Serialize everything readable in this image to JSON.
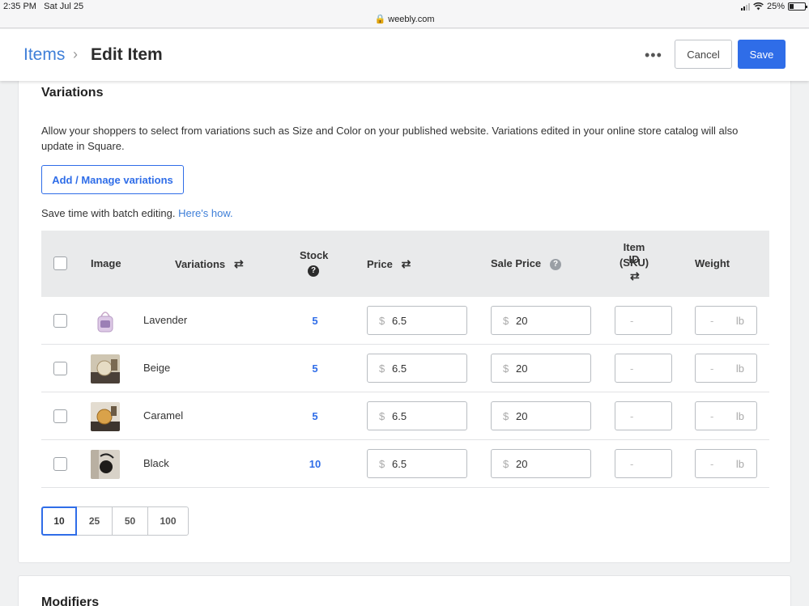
{
  "status_bar": {
    "time": "2:35 PM",
    "date": "Sat Jul 25",
    "url": "weebly.com",
    "battery": "25%"
  },
  "header": {
    "breadcrumb_link": "Items",
    "breadcrumb_sep": "›",
    "title": "Edit Item",
    "more": "•••",
    "cancel_label": "Cancel",
    "save_label": "Save",
    "accent": "#2f6de8"
  },
  "variations": {
    "title": "Variations",
    "description": "Allow your shoppers to select from variations such as Size and Color on your published website. Variations edited in your online store catalog will also update in Square.",
    "manage_label": "Add / Manage variations",
    "batch_text": "Save time with batch editing.",
    "batch_link": "Here's how.",
    "columns": {
      "image": "Image",
      "variations": "Variations",
      "stock": "Stock",
      "price": "Price",
      "sale_price": "Sale Price",
      "item_id": "Item ID",
      "sku": "(SKU)",
      "weight": "Weight"
    },
    "currency": "$",
    "placeholder_dash": "-",
    "weight_unit": "lb",
    "rows": [
      {
        "name": "Lavender",
        "stock": "5",
        "price": "6.5",
        "sale_price": "20"
      },
      {
        "name": "Beige",
        "stock": "5",
        "price": "6.5",
        "sale_price": "20"
      },
      {
        "name": "Caramel",
        "stock": "5",
        "price": "6.5",
        "sale_price": "20"
      },
      {
        "name": "Black",
        "stock": "10",
        "price": "6.5",
        "sale_price": "20"
      }
    ],
    "page_sizes": [
      "10",
      "25",
      "50",
      "100"
    ],
    "active_page_size": "10"
  },
  "modifiers": {
    "title": "Modifiers"
  }
}
